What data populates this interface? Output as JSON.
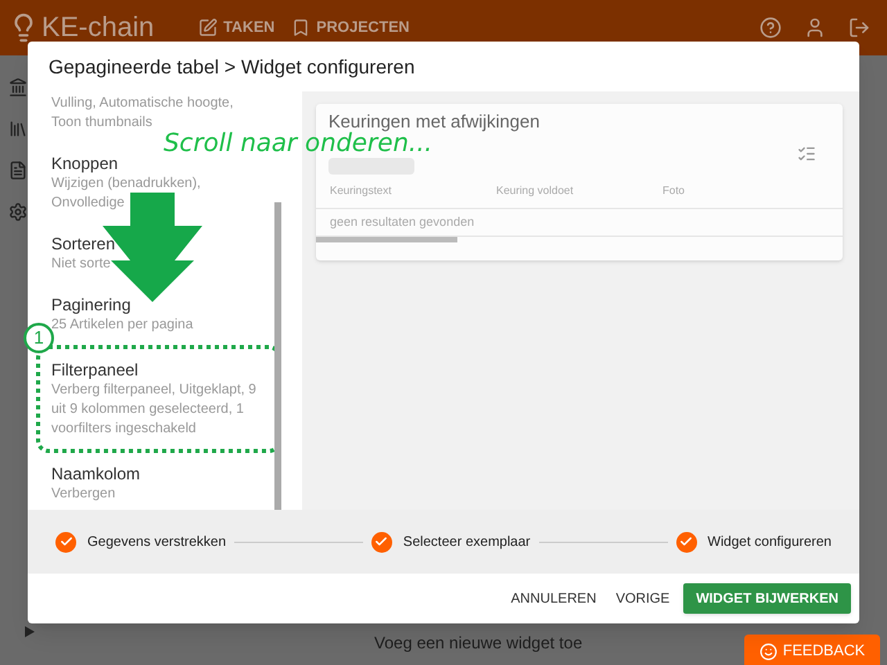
{
  "app": {
    "logo": "KE-chain",
    "nav": [
      {
        "label": "TAKEN"
      },
      {
        "label": "PROJECTEN"
      }
    ]
  },
  "background": {
    "add_widget": "Voeg een nieuwe widget toe",
    "feedback": "FEEDBACK"
  },
  "dialog": {
    "title": "Gepagineerde tabel > Widget configureren",
    "settings": [
      {
        "subtitle": "Vulling, Automatische hoogte, Toon thumbnails",
        "highlighted": false
      },
      {
        "title": "Knoppen",
        "subtitle": "Wijzigen (benadrukken), Onvolledige",
        "highlighted": false
      },
      {
        "title": "Sorteren",
        "subtitle": "Niet sorte",
        "highlighted": false
      },
      {
        "title": "Paginering",
        "subtitle": "25 Artikelen per pagina",
        "highlighted": false
      },
      {
        "title": "Filterpaneel",
        "subtitle": "Verberg filterpaneel, Uitgeklapt, 9 uit 9 kolommen geselecteerd, 1 voorfilters ingeschakeld",
        "highlighted": true
      },
      {
        "title": "Naamkolom",
        "subtitle": "Verbergen",
        "highlighted": false
      }
    ],
    "preview": {
      "title": "Keuringen met afwijkingen",
      "columns": [
        "Keuringstext",
        "Keuring voldoet",
        "Foto"
      ],
      "empty_text": "geen resultaten gevonden"
    },
    "steps": [
      {
        "label": "Gegevens verstrekken",
        "done": true
      },
      {
        "label": "Selecteer exemplaar",
        "done": true
      },
      {
        "label": "Widget configureren",
        "done": true
      }
    ],
    "buttons": [
      {
        "label": "ANNULEREN",
        "kind": "text"
      },
      {
        "label": "VORIGE",
        "kind": "text"
      },
      {
        "label": "WIDGET BIJWERKEN",
        "kind": "primary"
      }
    ]
  },
  "annotation": {
    "text": "Scroll naar onderen...",
    "badge": "1"
  }
}
